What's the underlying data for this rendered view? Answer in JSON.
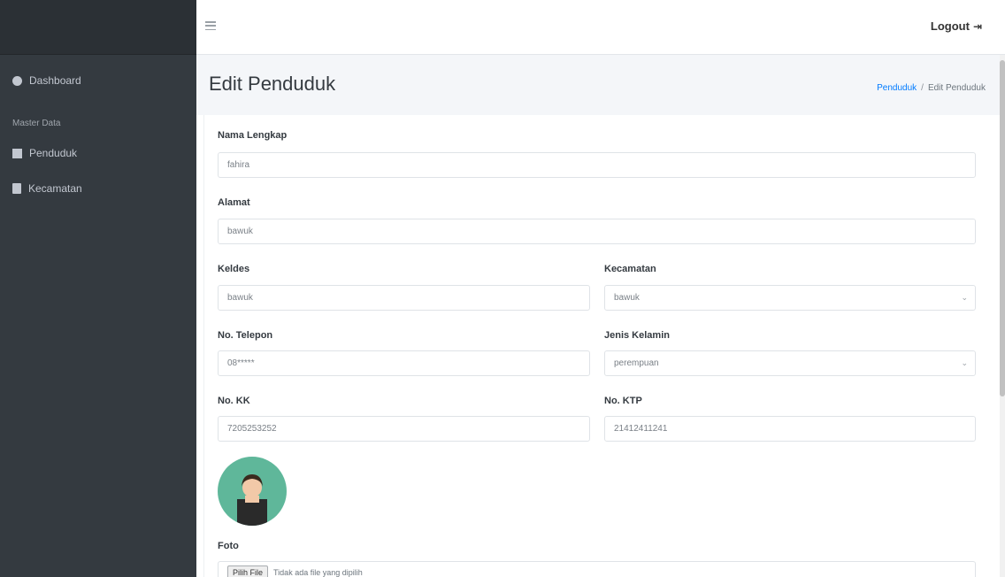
{
  "sidebar": {
    "items": [
      {
        "label": "Dashboard",
        "icon": "dashboard-icon"
      },
      {
        "label": "Penduduk",
        "icon": "id-card-icon"
      },
      {
        "label": "Kecamatan",
        "icon": "document-icon"
      }
    ],
    "section_header": "Master Data"
  },
  "topbar": {
    "logout_label": "Logout",
    "logout_icon": "logout-icon"
  },
  "header": {
    "title": "Edit Penduduk",
    "breadcrumb": [
      "Penduduk",
      "Edit Penduduk"
    ]
  },
  "form": {
    "nama": {
      "label": "Nama Lengkap",
      "value": "fahira"
    },
    "alamat": {
      "label": "Alamat",
      "value": "bawuk"
    },
    "keldes": {
      "label": "Keldes",
      "value": "bawuk"
    },
    "kecamatan": {
      "label": "Kecamatan",
      "value": "bawuk"
    },
    "telepon": {
      "label": "No. Telepon",
      "value": "08*****"
    },
    "jenis_kelamin": {
      "label": "Jenis Kelamin",
      "value": "perempuan"
    },
    "kk": {
      "label": "No. KK",
      "value": "7205253252"
    },
    "ktp": {
      "label": "No. KTP",
      "value": "21412411241"
    },
    "foto": {
      "label": "Foto",
      "button_label": "Pilih File",
      "no_file_text": "Tidak ada file yang dipilih"
    }
  },
  "colors": {
    "sidebar_bg": "#343a40",
    "accent_link": "#007bff",
    "avatar_bg": "#5fb79a"
  }
}
